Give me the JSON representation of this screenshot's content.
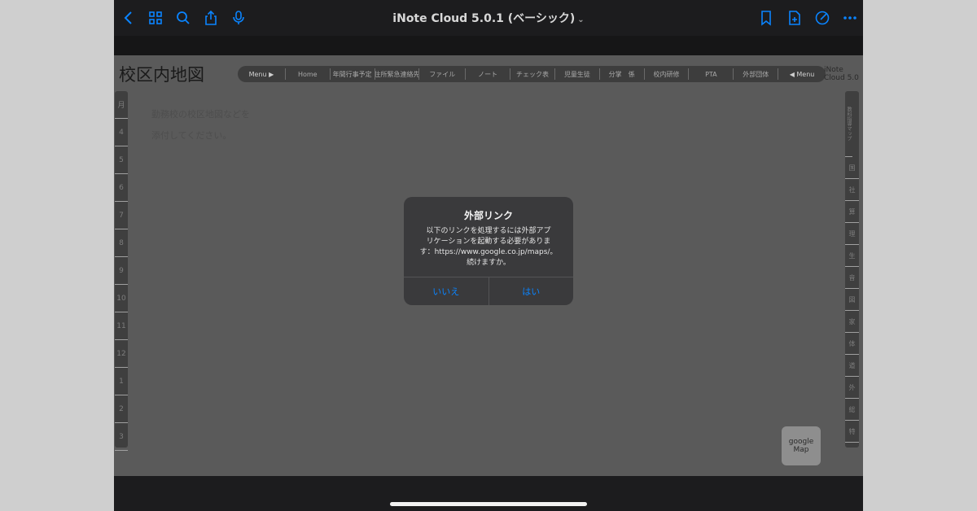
{
  "toolbar": {
    "title": "iNote Cloud 5.0.1 (ベーシック)",
    "title_chevron": "⌄",
    "left_icons": [
      "chevron-left-icon",
      "grid-icon",
      "search-icon",
      "share-icon",
      "microphone-icon"
    ],
    "right_icons": [
      "bookmark-icon",
      "add-page-icon",
      "compose-icon",
      "more-icon"
    ],
    "accent_color": "#0a84ff"
  },
  "page": {
    "title": "校区内地図",
    "version": "iNote Cloud 5.0",
    "body_lines": [
      "勤務校の校区地図などを",
      "添付してください。"
    ],
    "menu": [
      "Menu ▶",
      "Home",
      "年間行事予定",
      "住所緊急連絡先",
      "ファイル",
      "ノート",
      "チェック表",
      "児童生徒",
      "分掌　係",
      "校内研修",
      "PTA",
      "外部団体",
      "◀ Menu"
    ],
    "months": [
      "月",
      "4",
      "5",
      "6",
      "7",
      "8",
      "9",
      "10",
      "11",
      "12",
      "1",
      "2",
      "3"
    ],
    "subjects_header": "教科指導マップ",
    "subjects": [
      "国",
      "社",
      "算",
      "理",
      "生",
      "音",
      "図",
      "家",
      "体",
      "道",
      "外",
      "総",
      "特"
    ],
    "google_map_label": "google Map"
  },
  "alert": {
    "title": "外部リンク",
    "message_lines": [
      "以下のリンクを処理するには外部アプ",
      "リケーションを起動する必要がありま",
      "す：https://www.google.co.jp/maps/。",
      "続けますか。"
    ],
    "cancel_label": "いいえ",
    "confirm_label": "はい"
  }
}
